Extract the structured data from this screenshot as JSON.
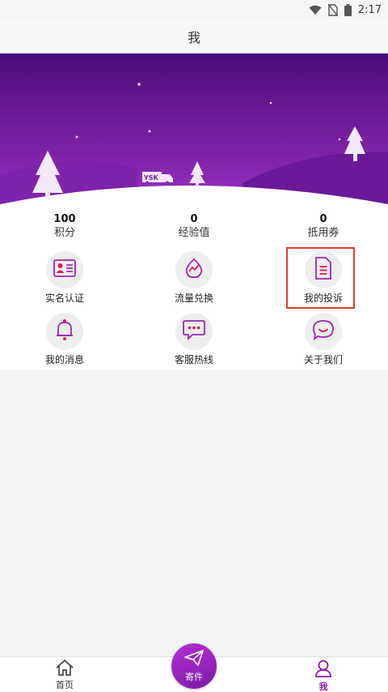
{
  "status_bar": {
    "time": "2:17",
    "icons": [
      "wifi-icon",
      "no-sim-icon",
      "battery-icon"
    ]
  },
  "header": {
    "title": "我"
  },
  "banner": {
    "truck_text": "YSK"
  },
  "stats": [
    {
      "value": "100",
      "label": "积分"
    },
    {
      "value": "0",
      "label": "经验值"
    },
    {
      "value": "0",
      "label": "抵用券"
    }
  ],
  "menu": [
    {
      "label": "实名认证",
      "icon": "id-card-icon"
    },
    {
      "label": "流量兑换",
      "icon": "data-exchange-icon"
    },
    {
      "label": "我的投诉",
      "icon": "complaint-document-icon"
    },
    {
      "label": "我的消息",
      "icon": "bell-icon"
    },
    {
      "label": "客服热线",
      "icon": "chat-bubble-icon"
    },
    {
      "label": "关于我们",
      "icon": "smile-icon"
    }
  ],
  "bottom_nav": {
    "home": {
      "label": "首页",
      "icon": "home-icon"
    },
    "send": {
      "label": "寄件",
      "icon": "paper-plane-icon"
    },
    "me": {
      "label": "我",
      "icon": "user-icon"
    }
  },
  "colors": {
    "accent": "#8e1ea6",
    "banner_top": "#4a0d78",
    "banner_bottom": "#9a2fc2",
    "highlight": "#e53935"
  }
}
